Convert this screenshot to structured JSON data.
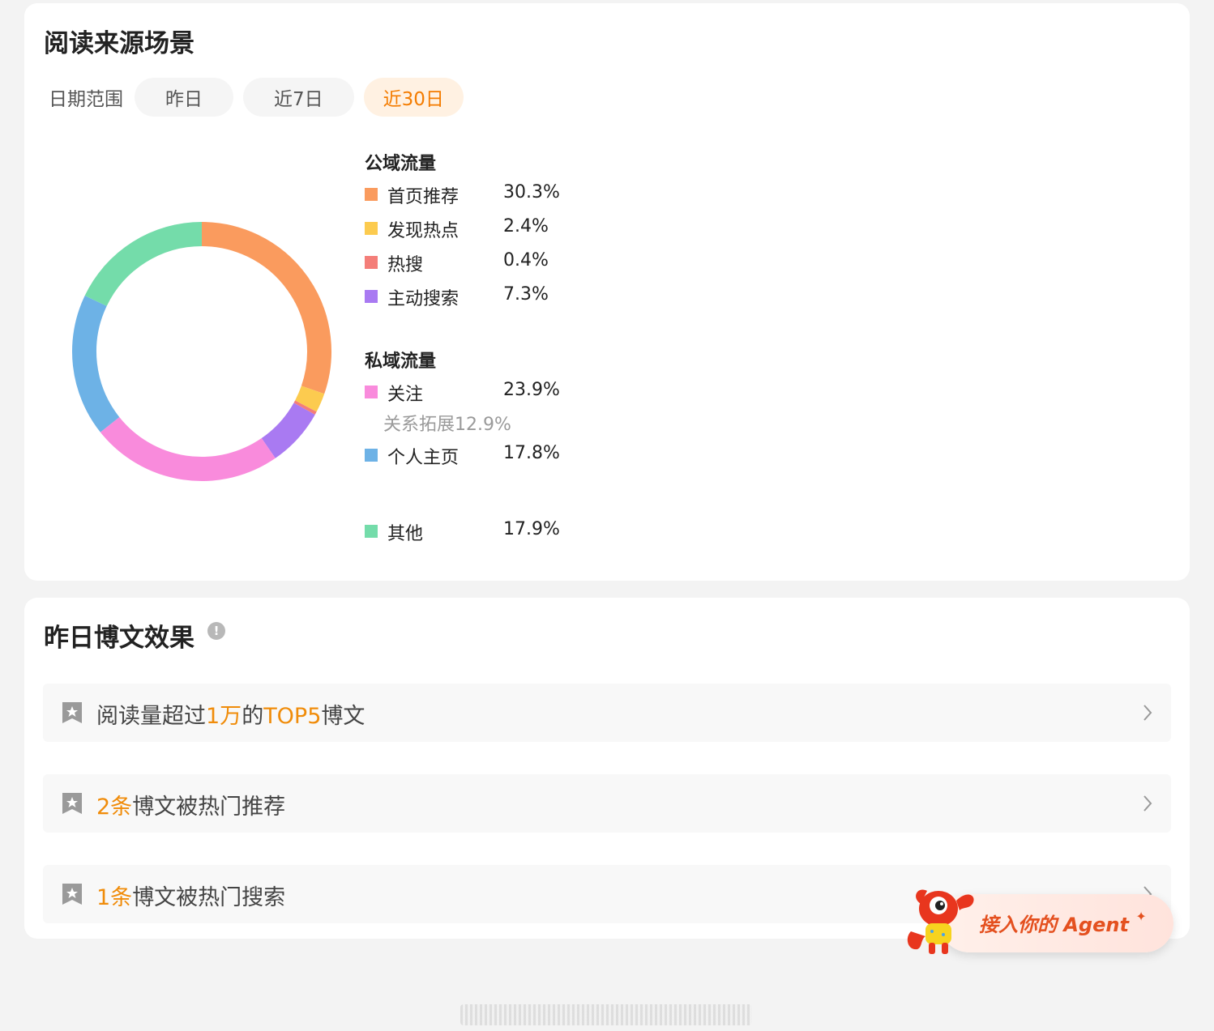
{
  "source_card": {
    "title": "阅读来源场景",
    "date_range": {
      "label": "日期范围",
      "options": [
        "昨日",
        "近7日",
        "近30日"
      ],
      "selected": "近30日"
    },
    "legend": {
      "public_title": "公域流量",
      "private_title": "私域流量",
      "public_items": [
        {
          "name": "首页推荐",
          "pct": "30.3%",
          "color": "#fa9b5e"
        },
        {
          "name": "发现热点",
          "pct": "2.4%",
          "color": "#fccb4f"
        },
        {
          "name": "热搜",
          "pct": "0.4%",
          "color": "#f47e79"
        },
        {
          "name": "主动搜索",
          "pct": "7.3%",
          "color": "#a97af2"
        }
      ],
      "private_items": [
        {
          "name": "关注",
          "pct": "23.9%",
          "color": "#f98bdc",
          "sub": "关系拓展12.9%"
        },
        {
          "name": "个人主页",
          "pct": "17.8%",
          "color": "#6db2e6"
        }
      ],
      "other": {
        "name": "其他",
        "pct": "17.9%",
        "color": "#74dcaa"
      }
    }
  },
  "chart_data": {
    "type": "pie",
    "title": "",
    "categories": [
      "首页推荐",
      "发现热点",
      "热搜",
      "主动搜索",
      "关注",
      "个人主页",
      "其他"
    ],
    "values": [
      30.3,
      2.4,
      0.4,
      7.3,
      23.9,
      17.8,
      17.9
    ],
    "colors": [
      "#fa9b5e",
      "#fccb4f",
      "#f47e79",
      "#a97af2",
      "#f98bdc",
      "#6db2e6",
      "#74dcaa"
    ],
    "style": "donut",
    "legend_placement": "right"
  },
  "effect_card": {
    "title": "昨日博文效果",
    "info_glyph": "!",
    "rows": [
      {
        "pre": "阅读量超过",
        "hl1": "1万",
        "mid": "的",
        "hl2": "TOP5",
        "post": "博文"
      },
      {
        "pre": "",
        "hl1": "2条",
        "mid": "博文被热门推荐",
        "hl2": "",
        "post": ""
      },
      {
        "pre": "",
        "hl1": "1条",
        "mid": "博文被热门搜索",
        "hl2": "",
        "post": ""
      }
    ]
  },
  "agent": {
    "label": "接入你的 Agent",
    "sparkle": "✦"
  },
  "icons": {
    "row_icon": "bookmark-star-icon",
    "chevron": "chevron-right-icon",
    "info": "info-icon"
  }
}
